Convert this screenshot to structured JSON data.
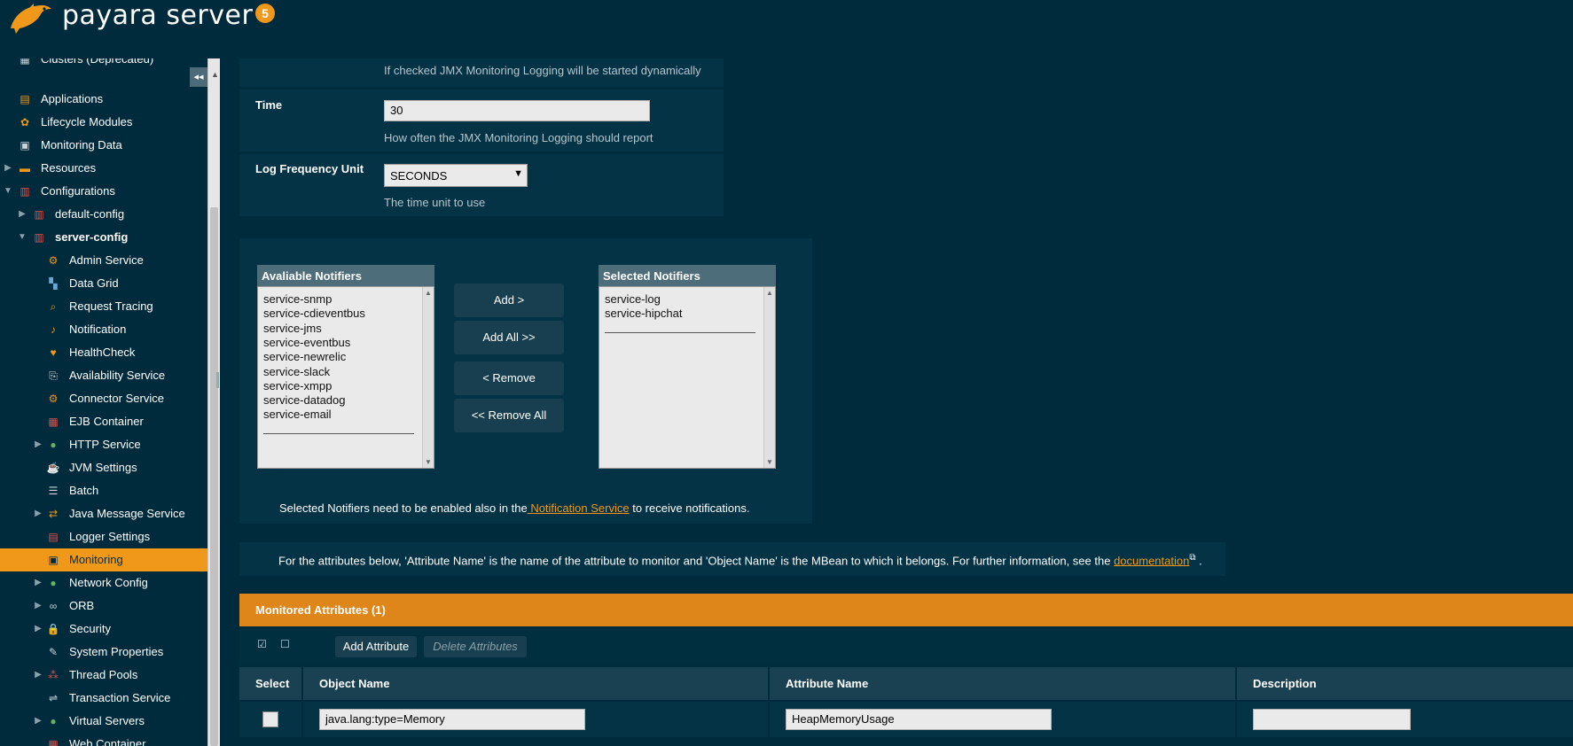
{
  "header": {
    "brand": "payara server",
    "version_badge": "5"
  },
  "sidebar": {
    "collapse_glyph": "◂◂",
    "partial_item": "Clusters (Deprecated)",
    "items": [
      {
        "label": "Applications",
        "icon": "applications-icon"
      },
      {
        "label": "Lifecycle Modules",
        "icon": "lifecycle-modules-icon"
      },
      {
        "label": "Monitoring Data",
        "icon": "monitoring-data-icon"
      },
      {
        "label": "Resources",
        "icon": "resources-icon"
      },
      {
        "label": "Configurations",
        "icon": "configurations-icon"
      },
      {
        "label": "default-config",
        "icon": "config-icon"
      },
      {
        "label": "server-config",
        "icon": "config-icon"
      },
      {
        "label": "Admin Service",
        "icon": "admin-service-icon"
      },
      {
        "label": "Data Grid",
        "icon": "data-grid-icon"
      },
      {
        "label": "Request Tracing",
        "icon": "request-tracing-icon"
      },
      {
        "label": "Notification",
        "icon": "notification-icon"
      },
      {
        "label": "HealthCheck",
        "icon": "healthcheck-icon"
      },
      {
        "label": "Availability Service",
        "icon": "availability-service-icon"
      },
      {
        "label": "Connector Service",
        "icon": "connector-service-icon"
      },
      {
        "label": "EJB Container",
        "icon": "ejb-container-icon"
      },
      {
        "label": "HTTP Service",
        "icon": "http-service-icon"
      },
      {
        "label": "JVM Settings",
        "icon": "jvm-settings-icon"
      },
      {
        "label": "Batch",
        "icon": "batch-icon"
      },
      {
        "label": "Java Message Service",
        "icon": "java-message-service-icon"
      },
      {
        "label": "Logger Settings",
        "icon": "logger-settings-icon"
      },
      {
        "label": "Monitoring",
        "icon": "monitoring-icon"
      },
      {
        "label": "Network Config",
        "icon": "network-config-icon"
      },
      {
        "label": "ORB",
        "icon": "orb-icon"
      },
      {
        "label": "Security",
        "icon": "security-icon"
      },
      {
        "label": "System Properties",
        "icon": "system-properties-icon"
      },
      {
        "label": "Thread Pools",
        "icon": "thread-pools-icon"
      },
      {
        "label": "Transaction Service",
        "icon": "transaction-service-icon"
      },
      {
        "label": "Virtual Servers",
        "icon": "virtual-servers-icon"
      },
      {
        "label": "Web Container",
        "icon": "web-container-icon"
      }
    ],
    "active_item": "Monitoring"
  },
  "form": {
    "enabled_help": "If checked JMX Monitoring Logging will be started dynamically",
    "time_label": "Time",
    "time_value": "30",
    "time_help": "How often the JMX Monitoring Logging should report",
    "unit_label": "Log Frequency Unit",
    "unit_value": "SECONDS",
    "unit_help": "The time unit to use"
  },
  "notifiers": {
    "available_header": "Avaliable Notifiers",
    "available": [
      "service-snmp",
      "service-cdieventbus",
      "service-jms",
      "service-eventbus",
      "service-newrelic",
      "service-slack",
      "service-xmpp",
      "service-datadog",
      "service-email"
    ],
    "selected_header": "Selected Notifiers",
    "selected": [
      "service-log",
      "service-hipchat"
    ],
    "add_label": "Add >",
    "add_all_label": "Add All >>",
    "remove_label": "< Remove",
    "remove_all_label": "<< Remove All",
    "note_prefix": "Selected Notifiers need to be enabled also in the",
    "note_link": " Notification Service",
    "note_suffix": " to receive notifications."
  },
  "attributes_info": {
    "text": "For the attributes below, 'Attribute Name' is the name of the attribute to monitor and 'Object Name' is the MBean to which it belongs. For further information, see the ",
    "link": "documentation",
    "suffix": " ."
  },
  "table": {
    "title": "Monitored Attributes (1)",
    "add_attribute_label": "Add Attribute",
    "delete_attributes_label": "Delete Attributes",
    "columns": [
      "Select",
      "Object Name",
      "Attribute Name",
      "Description"
    ],
    "rows": [
      {
        "object_name": "java.lang:type=Memory",
        "attribute_name": "HeapMemoryUsage",
        "description": ""
      }
    ]
  },
  "colors": {
    "background": "#002b3c",
    "accent": "#f0981a",
    "panel": "#033344",
    "link": "#f0981a"
  }
}
